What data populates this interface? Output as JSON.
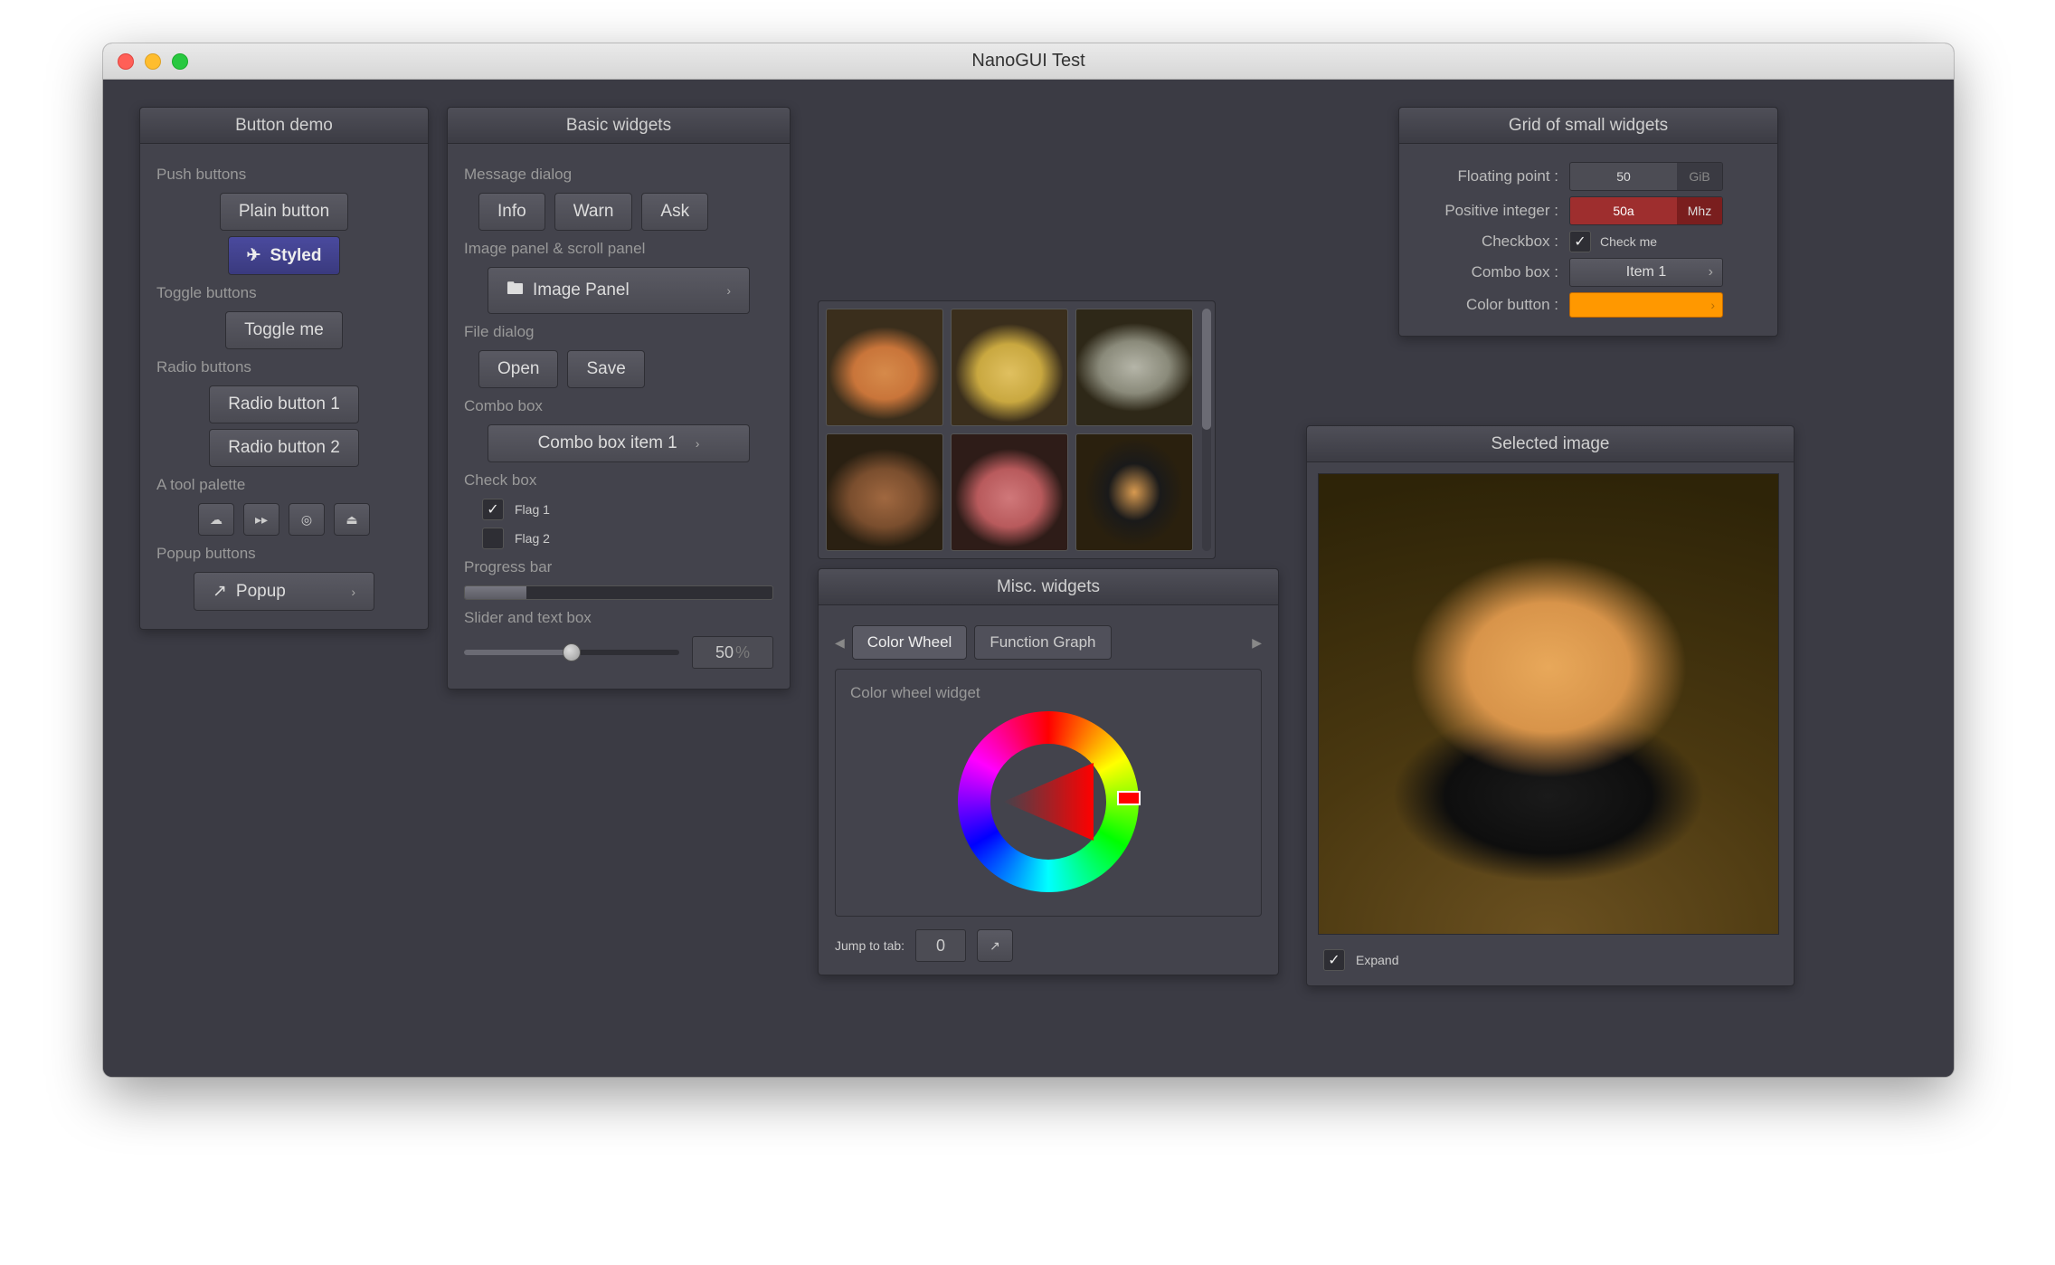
{
  "window": {
    "title": "NanoGUI Test"
  },
  "button_demo": {
    "title": "Button demo",
    "push_label": "Push buttons",
    "plain": "Plain button",
    "styled": "Styled",
    "toggle_label": "Toggle buttons",
    "toggle": "Toggle me",
    "radio_label": "Radio buttons",
    "radio1": "Radio button 1",
    "radio2": "Radio button 2",
    "tool_label": "A tool palette",
    "popup_label": "Popup buttons",
    "popup": "Popup"
  },
  "basic": {
    "title": "Basic widgets",
    "msg_label": "Message dialog",
    "info": "Info",
    "warn": "Warn",
    "ask": "Ask",
    "img_label": "Image panel & scroll panel",
    "img_panel": "Image Panel",
    "file_label": "File dialog",
    "open": "Open",
    "save": "Save",
    "combo_label": "Combo box",
    "combo_val": "Combo box item 1",
    "check_label": "Check box",
    "flag1": "Flag 1",
    "flag2": "Flag 2",
    "progress_label": "Progress bar",
    "slider_label": "Slider and text box",
    "slider_val": "50",
    "slider_unit": "%"
  },
  "grid": {
    "title": "Grid of small widgets",
    "float_label": "Floating point :",
    "float_val": "50",
    "float_unit": "GiB",
    "int_label": "Positive integer :",
    "int_val": "50a",
    "int_unit": "Mhz",
    "check_label": "Checkbox :",
    "check_text": "Check me",
    "combo_label": "Combo box :",
    "combo_val": "Item 1",
    "color_label": "Color button :",
    "color_val": "#ff9800"
  },
  "misc": {
    "title": "Misc. widgets",
    "tab1": "Color Wheel",
    "tab2": "Function Graph",
    "cw_label": "Color wheel widget",
    "jump_label": "Jump to tab:",
    "jump_val": "0"
  },
  "selected": {
    "title": "Selected image",
    "expand": "Expand"
  },
  "image_popup": {
    "thumbs": [
      "sushi-salmon",
      "sushi-tamago",
      "sushi-saba",
      "sushi-unagi",
      "sushi-tuna",
      "sushi-uni-thumb"
    ]
  }
}
